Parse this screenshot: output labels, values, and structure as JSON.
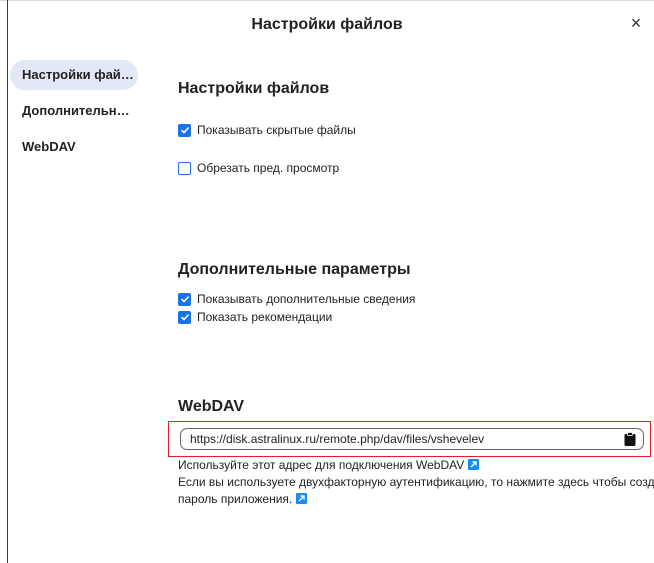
{
  "dialog": {
    "title": "Настройки файлов",
    "close_label": "×"
  },
  "nav": {
    "items": [
      {
        "label": "Настройки файл..."
      },
      {
        "label": "Дополнительны..."
      },
      {
        "label": "WebDAV"
      }
    ]
  },
  "sections": {
    "files": {
      "title": "Настройки файлов",
      "options": [
        {
          "label": "Показывать скрытые файлы",
          "checked": true
        },
        {
          "label": "Обрезать пред. просмотр",
          "checked": false
        }
      ]
    },
    "additional": {
      "title": "Дополнительные параметры",
      "options": [
        {
          "label": "Показывать дополнительные сведения",
          "checked": true
        },
        {
          "label": "Показать рекомендации",
          "checked": true
        }
      ]
    },
    "webdav": {
      "title": "WebDAV",
      "url": "https://disk.astralinux.ru/remote.php/dav/files/vshevelev",
      "hint_1": "Используйте этот адрес для подключения WebDAV",
      "hint_2": "Если вы используете двухфакторную аутентификацию, то нажмите здесь чтобы создать",
      "hint_3": "пароль приложения."
    }
  },
  "colors": {
    "accent": "#1a73e8",
    "nav_active_bg": "#e3e8f7",
    "highlight": "#e0202a",
    "external_link": "#1a8cf0"
  }
}
